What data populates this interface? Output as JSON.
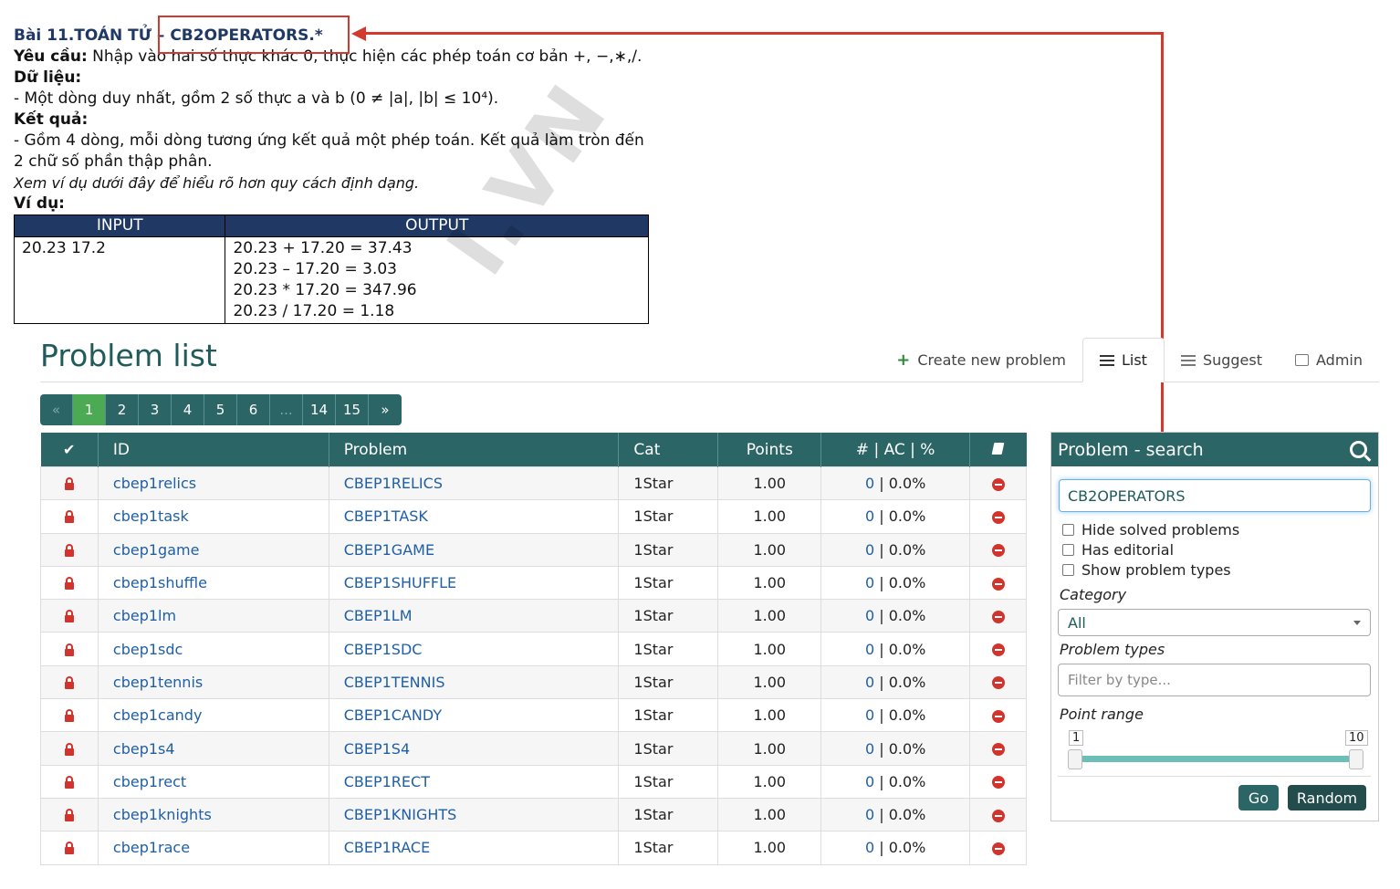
{
  "doc": {
    "title_prefix": "Bài 11.TOÁN TỬ –",
    "title_code": "CB2OPERATORS.*",
    "req_label": "Yêu cầu:",
    "req_text": "Nhập vào hai số thực khác 0, thực hiện các phép toán cơ bản +, −,∗,/.",
    "data_label": "Dữ liệu:",
    "data_text": "- Một dòng duy nhất, gồm 2 số thực a và b (0 ≠ |a|, |b| ≤ 10⁴).",
    "result_label": "Kết quả:",
    "result_text": "- Gồm 4 dòng, mỗi dòng tương ứng kết quả một phép toán. Kết quả làm tròn đến 2 chữ số phần thập phân.",
    "note_text": "Xem ví dụ dưới đây để hiểu rõ hơn quy cách định dạng.",
    "example_label": "Ví dụ:",
    "table": {
      "input_header": "INPUT",
      "output_header": "OUTPUT",
      "input": "20.23 17.2",
      "output": [
        "20.23 + 17.20 = 37.43",
        "20.23 – 17.20 = 3.03",
        "20.23 * 17.20 = 347.96",
        "20.23 / 17.20 = 1.18"
      ]
    },
    "watermark": "I.VN"
  },
  "header": {
    "title": "Problem list",
    "nav": {
      "create": "Create new problem",
      "list": "List",
      "suggest": "Suggest",
      "admin": "Admin"
    }
  },
  "pagination": {
    "prev": "«",
    "pages": [
      "1",
      "2",
      "3",
      "4",
      "5",
      "6",
      "...",
      "14",
      "15"
    ],
    "next": "»",
    "current": "1"
  },
  "table": {
    "headers": {
      "id": "ID",
      "problem": "Problem",
      "cat": "Cat",
      "points": "Points",
      "stats": "# | AC | %"
    },
    "rows": [
      {
        "id": "cbep1relics",
        "name": "CBEP1RELICS",
        "cat": "1Star",
        "points": "1.00",
        "count": "0",
        "ac": "| 0.0%"
      },
      {
        "id": "cbep1task",
        "name": "CBEP1TASK",
        "cat": "1Star",
        "points": "1.00",
        "count": "0",
        "ac": "| 0.0%"
      },
      {
        "id": "cbep1game",
        "name": "CBEP1GAME",
        "cat": "1Star",
        "points": "1.00",
        "count": "0",
        "ac": "| 0.0%"
      },
      {
        "id": "cbep1shuffle",
        "name": "CBEP1SHUFFLE",
        "cat": "1Star",
        "points": "1.00",
        "count": "0",
        "ac": "| 0.0%"
      },
      {
        "id": "cbep1lm",
        "name": "CBEP1LM",
        "cat": "1Star",
        "points": "1.00",
        "count": "0",
        "ac": "| 0.0%"
      },
      {
        "id": "cbep1sdc",
        "name": "CBEP1SDC",
        "cat": "1Star",
        "points": "1.00",
        "count": "0",
        "ac": "| 0.0%"
      },
      {
        "id": "cbep1tennis",
        "name": "CBEP1TENNIS",
        "cat": "1Star",
        "points": "1.00",
        "count": "0",
        "ac": "| 0.0%"
      },
      {
        "id": "cbep1candy",
        "name": "CBEP1CANDY",
        "cat": "1Star",
        "points": "1.00",
        "count": "0",
        "ac": "| 0.0%"
      },
      {
        "id": "cbep1s4",
        "name": "CBEP1S4",
        "cat": "1Star",
        "points": "1.00",
        "count": "0",
        "ac": "| 0.0%"
      },
      {
        "id": "cbep1rect",
        "name": "CBEP1RECT",
        "cat": "1Star",
        "points": "1.00",
        "count": "0",
        "ac": "| 0.0%"
      },
      {
        "id": "cbep1knights",
        "name": "CBEP1KNIGHTS",
        "cat": "1Star",
        "points": "1.00",
        "count": "0",
        "ac": "| 0.0%"
      },
      {
        "id": "cbep1race",
        "name": "CBEP1RACE",
        "cat": "1Star",
        "points": "1.00",
        "count": "0",
        "ac": "| 0.0%"
      }
    ]
  },
  "search": {
    "title": "Problem - search",
    "query": "CB2OPERATORS",
    "hide_solved": "Hide solved problems",
    "has_editorial": "Has editorial",
    "show_types": "Show problem types",
    "category_label": "Category",
    "category_value": "All",
    "types_label": "Problem types",
    "types_placeholder": "Filter by type...",
    "range_label": "Point range",
    "range_min": "1",
    "range_max": "10",
    "go": "Go",
    "random": "Random"
  },
  "colors": {
    "teal": "#2c6566",
    "active_page": "#4caa55",
    "link": "#1f5fa6",
    "annotation_red": "#d23a2e"
  }
}
